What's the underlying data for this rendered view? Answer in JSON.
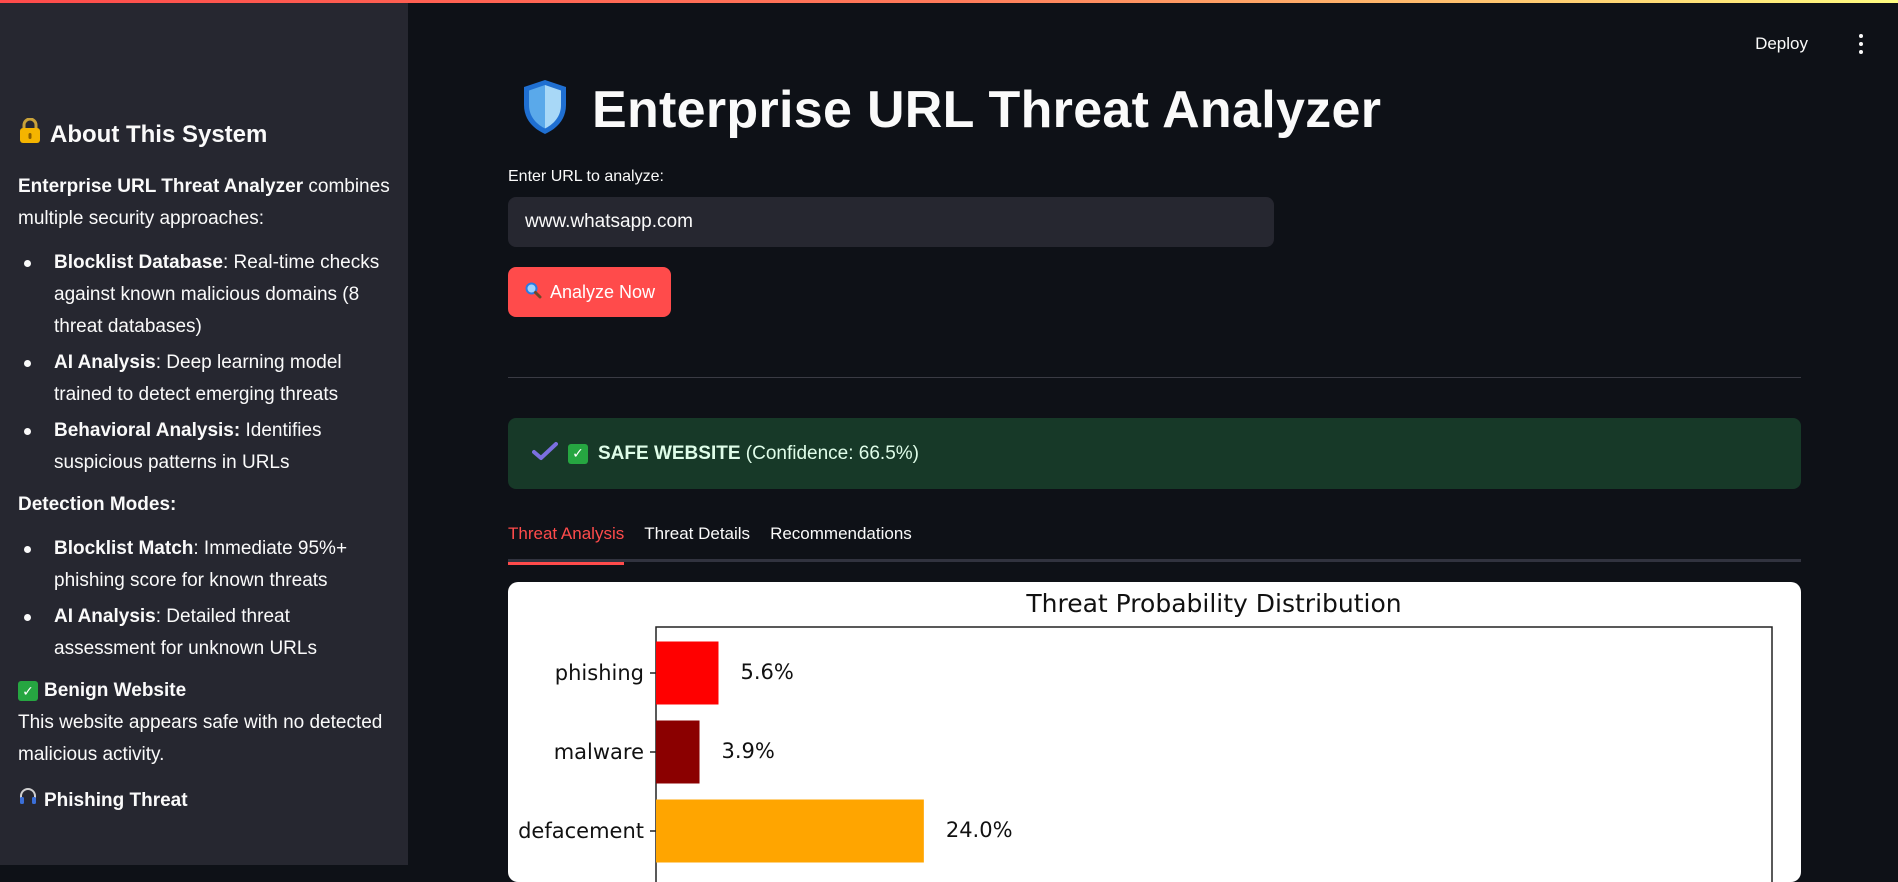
{
  "sidebar": {
    "title": "About This System",
    "intro_bold": "Enterprise URL Threat Analyzer",
    "intro_rest": " combines multiple security approaches:",
    "approaches": [
      {
        "bold": "Blocklist Database",
        "text": ": Real-time checks against known malicious domains (8 threat databases)"
      },
      {
        "bold": "AI Analysis",
        "text": ": Deep learning model trained to detect emerging threats"
      },
      {
        "bold": "Behavioral Analysis:",
        "text": " Identifies suspicious patterns in URLs"
      }
    ],
    "modes_heading": "Detection Modes:",
    "modes": [
      {
        "bold": "Blocklist Match",
        "text": ": Immediate 95%+ phishing score for known threats"
      },
      {
        "bold": "AI Analysis",
        "text": ": Detailed threat assessment for unknown URLs"
      }
    ],
    "benign_title": "Benign Website",
    "benign_text": "This website appears safe with no detected malicious activity.",
    "phishing_title": "Phishing Threat"
  },
  "header": {
    "deploy_label": "Deploy"
  },
  "main": {
    "title": "Enterprise URL Threat Analyzer",
    "url_label": "Enter URL to analyze:",
    "url_value": "www.whatsapp.com",
    "analyze_button": "Analyze Now",
    "result_bold": "SAFE WEBSITE",
    "result_rest": " (Confidence: 66.5%)",
    "tabs": [
      "Threat Analysis",
      "Threat Details",
      "Recommendations"
    ],
    "active_tab": 0
  },
  "colors": {
    "accent": "#ff4b4b",
    "success_bg": "#173928",
    "sidebar_bg": "#262730",
    "page_bg": "#0e1117"
  },
  "chart_data": {
    "type": "bar",
    "orientation": "horizontal",
    "title": "Threat Probability Distribution",
    "categories": [
      "phishing",
      "malware",
      "defacement"
    ],
    "values": [
      5.6,
      3.9,
      24.0
    ],
    "labels": [
      "5.6%",
      "3.9%",
      "24.0%"
    ],
    "colors": [
      "#ff0000",
      "#8b0000",
      "#ffa500"
    ],
    "xlim": [
      0,
      100
    ]
  }
}
